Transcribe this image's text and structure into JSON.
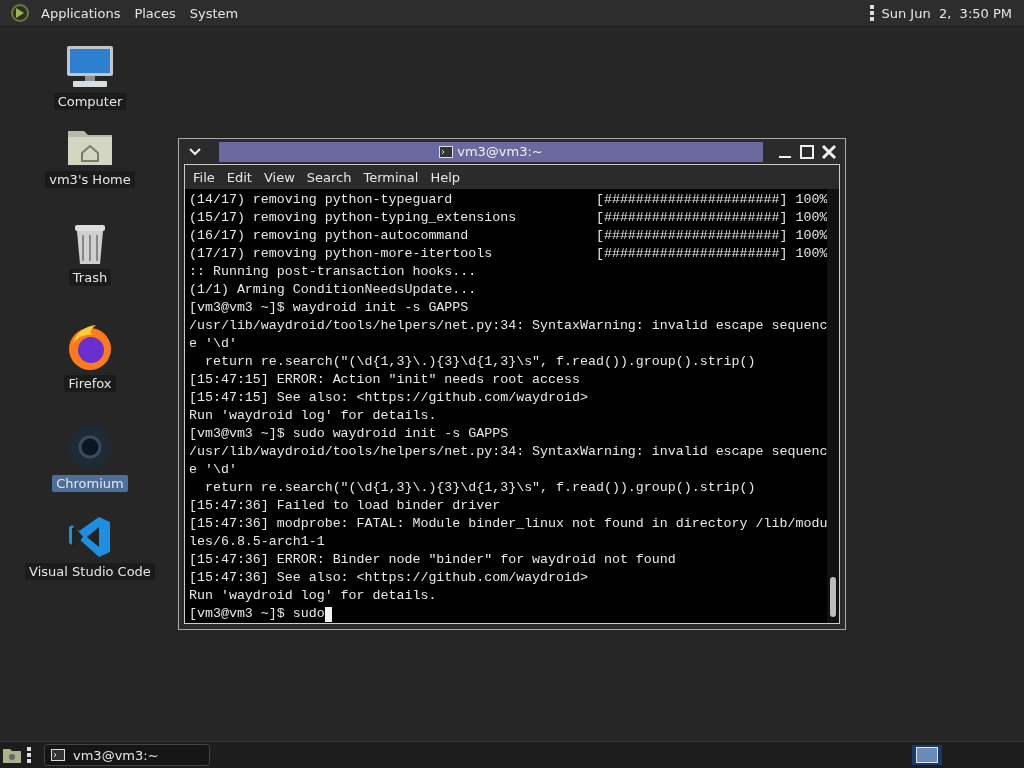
{
  "top_panel": {
    "menus": [
      "Applications",
      "Places",
      "System"
    ],
    "clock": "Sun Jun  2,  3:50 PM"
  },
  "desktop_icons": [
    {
      "label": "Computer",
      "kind": "computer",
      "selected": false
    },
    {
      "label": "vm3's Home",
      "kind": "home",
      "selected": false
    },
    {
      "label": "Trash",
      "kind": "trash",
      "selected": false
    },
    {
      "label": "Firefox",
      "kind": "firefox",
      "selected": false
    },
    {
      "label": "Chromium",
      "kind": "chromium",
      "selected": true
    },
    {
      "label": "Visual Studio Code",
      "kind": "vscode",
      "selected": false
    }
  ],
  "terminal": {
    "title": "vm3@vm3:~",
    "menu": [
      "File",
      "Edit",
      "View",
      "Search",
      "Terminal",
      "Help"
    ],
    "lines": [
      "(14/17) removing python-typeguard                  [######################] 100%",
      "(15/17) removing python-typing_extensions          [######################] 100%",
      "(16/17) removing python-autocommand                [######################] 100%",
      "(17/17) removing python-more-itertools             [######################] 100%",
      ":: Running post-transaction hooks...",
      "(1/1) Arming ConditionNeedsUpdate...",
      "[vm3@vm3 ~]$ waydroid init -s GAPPS",
      "/usr/lib/waydroid/tools/helpers/net.py:34: SyntaxWarning: invalid escape sequenc",
      "e '\\d'",
      "  return re.search(\"(\\d{1,3}\\.){3}\\d{1,3}\\s\", f.read()).group().strip()",
      "[15:47:15] ERROR: Action \"init\" needs root access",
      "[15:47:15] See also: <https://github.com/waydroid>",
      "Run 'waydroid log' for details.",
      "[vm3@vm3 ~]$ sudo waydroid init -s GAPPS",
      "/usr/lib/waydroid/tools/helpers/net.py:34: SyntaxWarning: invalid escape sequenc",
      "e '\\d'",
      "  return re.search(\"(\\d{1,3}\\.){3}\\d{1,3}\\s\", f.read()).group().strip()",
      "[15:47:36] Failed to load binder driver",
      "[15:47:36] modprobe: FATAL: Module binder_linux not found in directory /lib/modu",
      "les/6.8.5-arch1-1",
      "[15:47:36] ERROR: Binder node \"binder\" for waydroid not found",
      "[15:47:36] See also: <https://github.com/waydroid>",
      "Run 'waydroid log' for details."
    ],
    "prompt": "[vm3@vm3 ~]$ sudo"
  },
  "taskbar": {
    "tasks": [
      {
        "label": "vm3@vm3:~",
        "selected": false
      }
    ],
    "workspaces": [
      {
        "selected": true
      }
    ]
  }
}
